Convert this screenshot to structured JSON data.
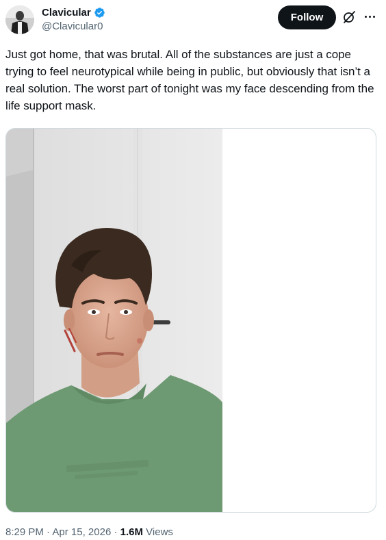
{
  "author": {
    "display_name": "Clavicular",
    "handle": "@Clavicular0",
    "verified": true,
    "verified_color": "#1d9bf0"
  },
  "actions": {
    "follow_label": "Follow",
    "grok_icon": "grok-icon",
    "more_icon": "more-icon"
  },
  "tweet": {
    "text": "Just got home, that was brutal. All of the substances are just a cope trying to feel neurotypical while being in public, but obviously that isn’t a real solution. The worst part of tonight was my face descending from the life support mask."
  },
  "media": {
    "photo_description_icon": "photo-selfie",
    "shirt_color": "#6e9a73"
  },
  "meta": {
    "time": "8:29 PM",
    "separator": "·",
    "date": "Apr 15, 2026",
    "views_count": "1.6M",
    "views_label": "Views"
  },
  "colors": {
    "text_primary": "#0f1419",
    "text_secondary": "#536471",
    "border": "#cfd9de"
  }
}
